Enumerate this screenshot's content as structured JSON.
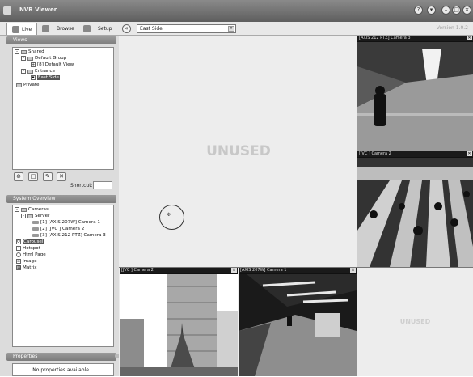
{
  "app": {
    "title": "NVR Viewer",
    "version": "Version 1.0.2"
  },
  "toolbar": {
    "tabs": [
      {
        "label": "Live"
      },
      {
        "label": "Browse"
      },
      {
        "label": "Setup"
      }
    ],
    "view_select": "East Side"
  },
  "views": {
    "header": "Views",
    "tree": {
      "shared": "Shared",
      "default_group": "Default Group",
      "default_view": "[8] Default View",
      "entrance": "Entrance",
      "east_side": "East Side",
      "private": "Private"
    },
    "shortcut_label": "Shortcut:"
  },
  "system_overview": {
    "header": "System Overview",
    "cameras": "Cameras",
    "server": "Server",
    "cam1": "[1] [AXIS 207W] Camera 1",
    "cam2": "[2] [JVC ] Camera 2",
    "cam3": "[3] [AXIS 212 PTZ] Camera 3",
    "carousel": "Carousel",
    "hotspot": "Hotspot",
    "html_page": "Html Page",
    "image": "Image",
    "matrix": "Matrix"
  },
  "properties": {
    "header": "Properties",
    "empty_text": "No properties available..."
  },
  "grid": {
    "unused_large": "UNUSED",
    "unused_small": "UNUSED",
    "tile_top_right": "[AXIS 212 PTZ] Camera 3",
    "tile_mid_right": "[JVC ] Camera 2",
    "tile_bottom_left": "[JVC ] Camera 2",
    "tile_bottom_mid": "[AXIS 207W] Camera 1"
  }
}
